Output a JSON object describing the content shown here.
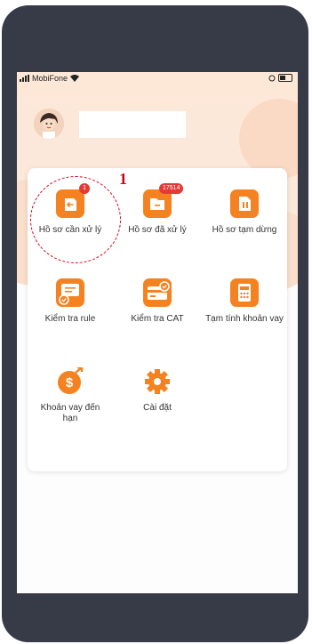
{
  "status_bar": {
    "carrier": "MobiFone"
  },
  "menu": {
    "items": [
      {
        "label": "Hồ sơ cần xử lý",
        "badge": "1"
      },
      {
        "label": "Hồ sơ đã xử lý",
        "badge": "17514"
      },
      {
        "label": "Hồ sơ tạm dừng"
      },
      {
        "label": "Kiểm tra rule"
      },
      {
        "label": "Kiểm tra CAT"
      },
      {
        "label": "Tạm tính khoản vay"
      },
      {
        "label": "Khoản vay đến hạn"
      },
      {
        "label": "Cài đặt"
      }
    ]
  },
  "annotation": {
    "marker": "1"
  },
  "colors": {
    "accent": "#f58220",
    "badge": "#e53935",
    "annotation": "#d0021b"
  }
}
